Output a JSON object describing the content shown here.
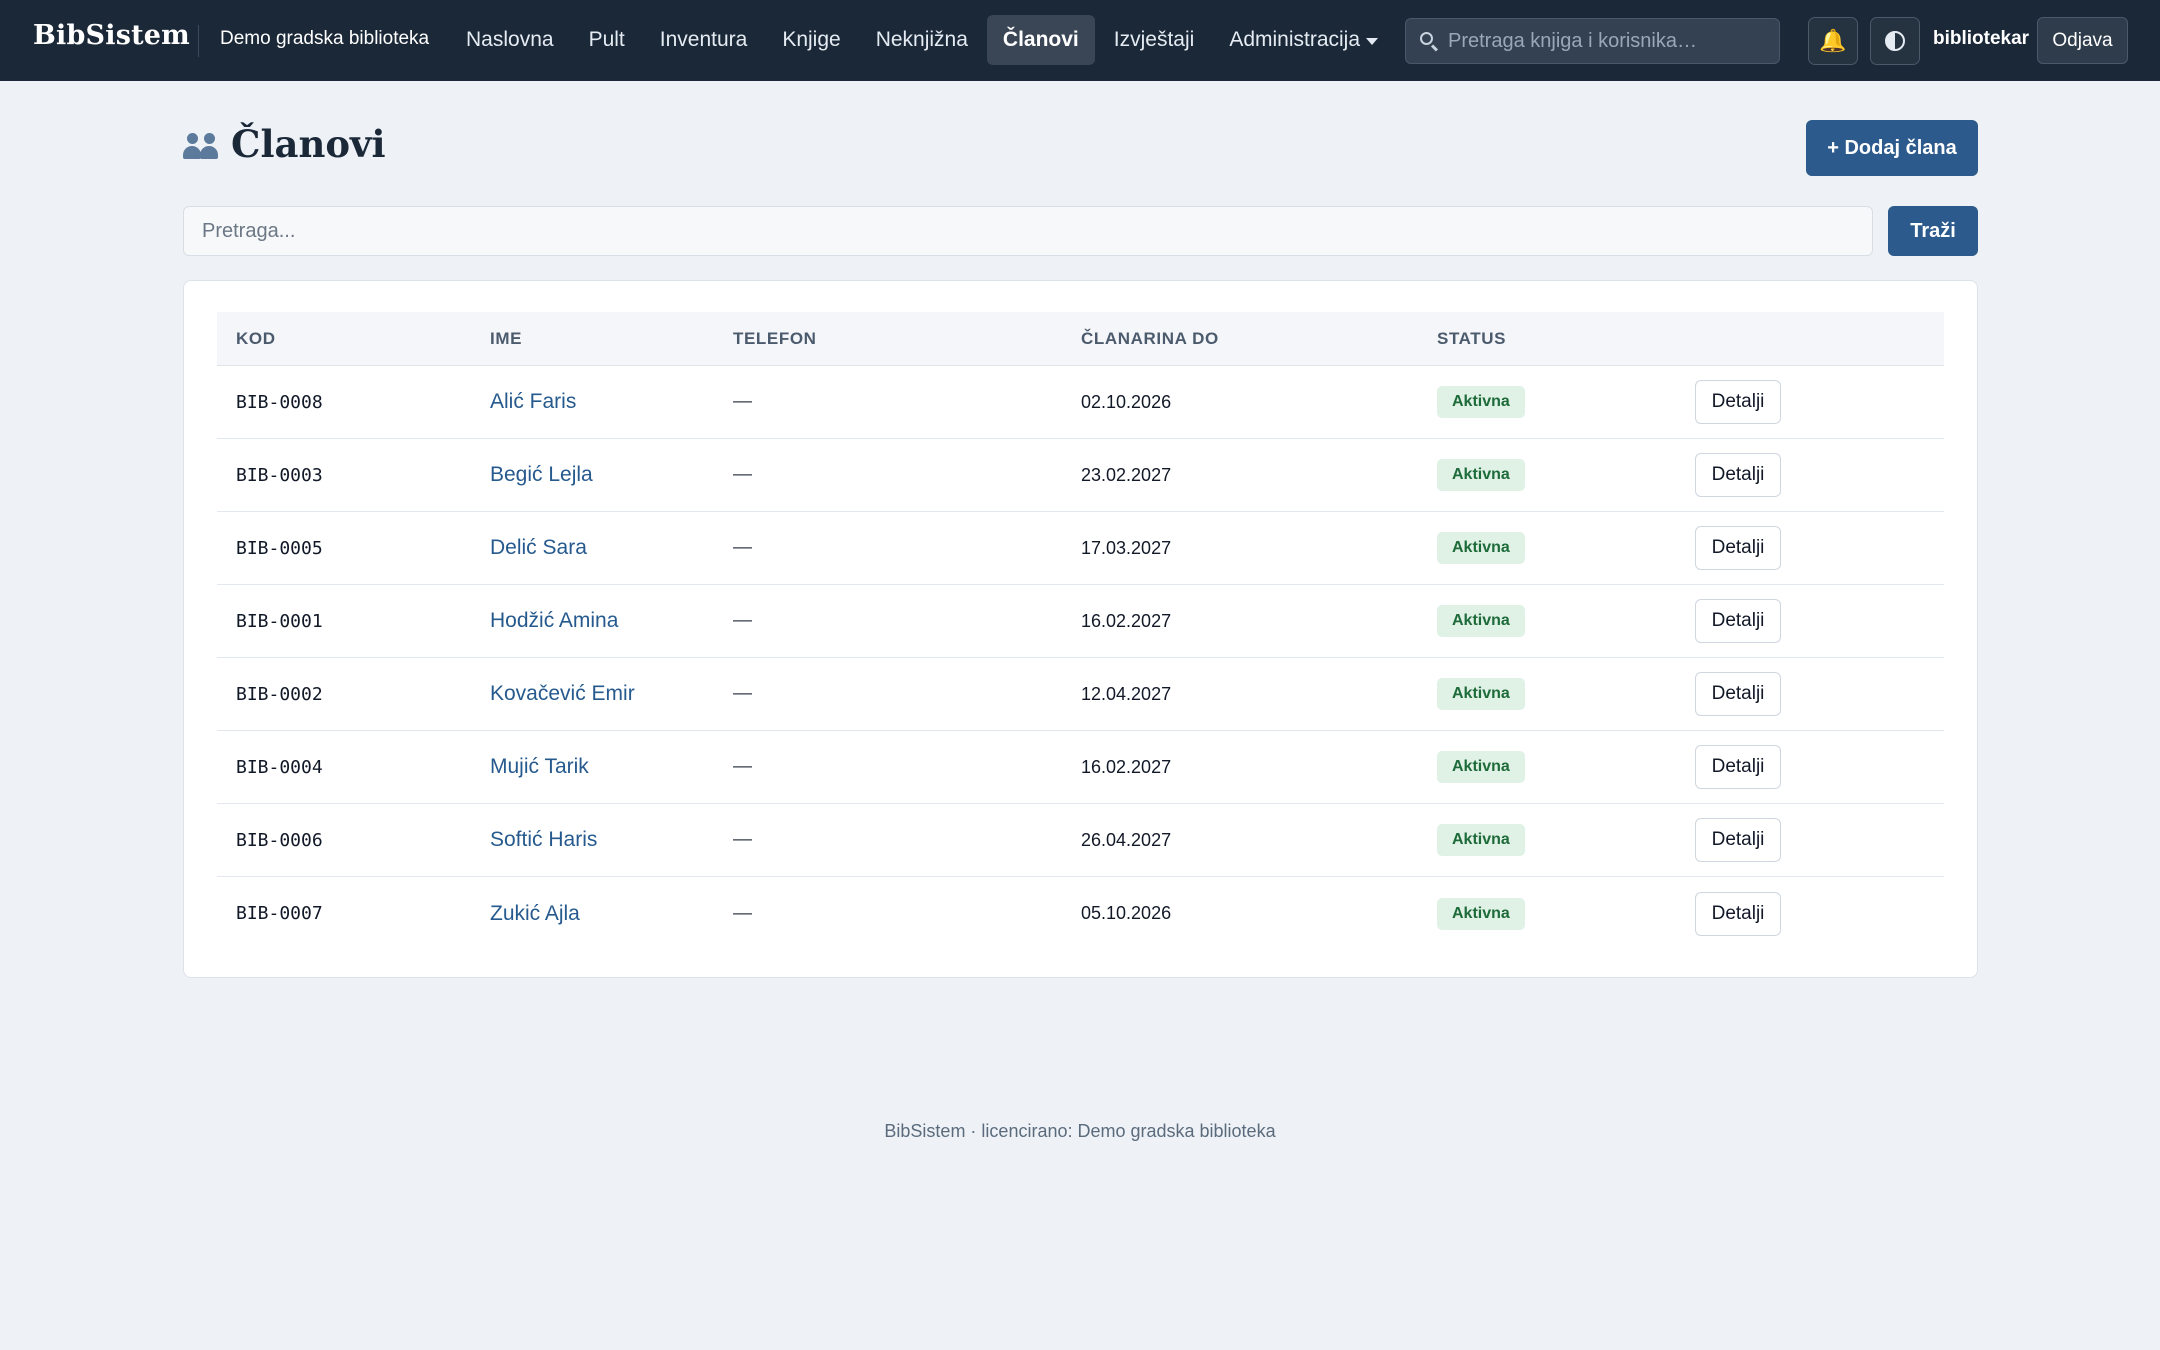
{
  "topbar": {
    "brand": "BibSistem",
    "org": "Demo gradska biblioteka",
    "nav": [
      "Naslovna",
      "Pult",
      "Inventura",
      "Knjige",
      "Neknjižna",
      "Članovi",
      "Izvještaji"
    ],
    "admin_label": "Administracija",
    "active": "Članovi",
    "search_placeholder": "Pretraga knjiga i korisnika…",
    "user": "bibliotekar",
    "logout": "Odjava"
  },
  "page": {
    "title": "Članovi",
    "add_button": "+ Dodaj člana",
    "search_placeholder": "Pretraga...",
    "search_button": "Traži"
  },
  "table": {
    "headers": {
      "kod": "KOD",
      "ime": "IME",
      "telefon": "TELEFON",
      "clanarina": "ČLANARINA DO",
      "status": "STATUS"
    },
    "rows": [
      {
        "kod": "BIB-0008",
        "ime": "Alić Faris",
        "telefon": "—",
        "clanarina": "02.10.2026",
        "status": "Aktivna",
        "action": "Detalji"
      },
      {
        "kod": "BIB-0003",
        "ime": "Begić Lejla",
        "telefon": "—",
        "clanarina": "23.02.2027",
        "status": "Aktivna",
        "action": "Detalji"
      },
      {
        "kod": "BIB-0005",
        "ime": "Delić Sara",
        "telefon": "—",
        "clanarina": "17.03.2027",
        "status": "Aktivna",
        "action": "Detalji"
      },
      {
        "kod": "BIB-0001",
        "ime": "Hodžić Amina",
        "telefon": "—",
        "clanarina": "16.02.2027",
        "status": "Aktivna",
        "action": "Detalji"
      },
      {
        "kod": "BIB-0002",
        "ime": "Kovačević Emir",
        "telefon": "—",
        "clanarina": "12.04.2027",
        "status": "Aktivna",
        "action": "Detalji"
      },
      {
        "kod": "BIB-0004",
        "ime": "Mujić Tarik",
        "telefon": "—",
        "clanarina": "16.02.2027",
        "status": "Aktivna",
        "action": "Detalji"
      },
      {
        "kod": "BIB-0006",
        "ime": "Softić Haris",
        "telefon": "—",
        "clanarina": "26.04.2027",
        "status": "Aktivna",
        "action": "Detalji"
      },
      {
        "kod": "BIB-0007",
        "ime": "Zukić Ajla",
        "telefon": "—",
        "clanarina": "05.10.2026",
        "status": "Aktivna",
        "action": "Detalji"
      }
    ]
  },
  "footer": {
    "text": "BibSistem · licencirano: Demo gradska biblioteka"
  },
  "icons": {
    "bell": "bell-icon",
    "theme": "contrast-icon",
    "search": "search-icon",
    "users": "users-icon"
  },
  "colors": {
    "topbar": "#1b2838",
    "accent": "#2c5a8c",
    "link": "#265a8e",
    "badge_bg": "#e0f1e6",
    "badge_text": "#1e6b3a"
  }
}
